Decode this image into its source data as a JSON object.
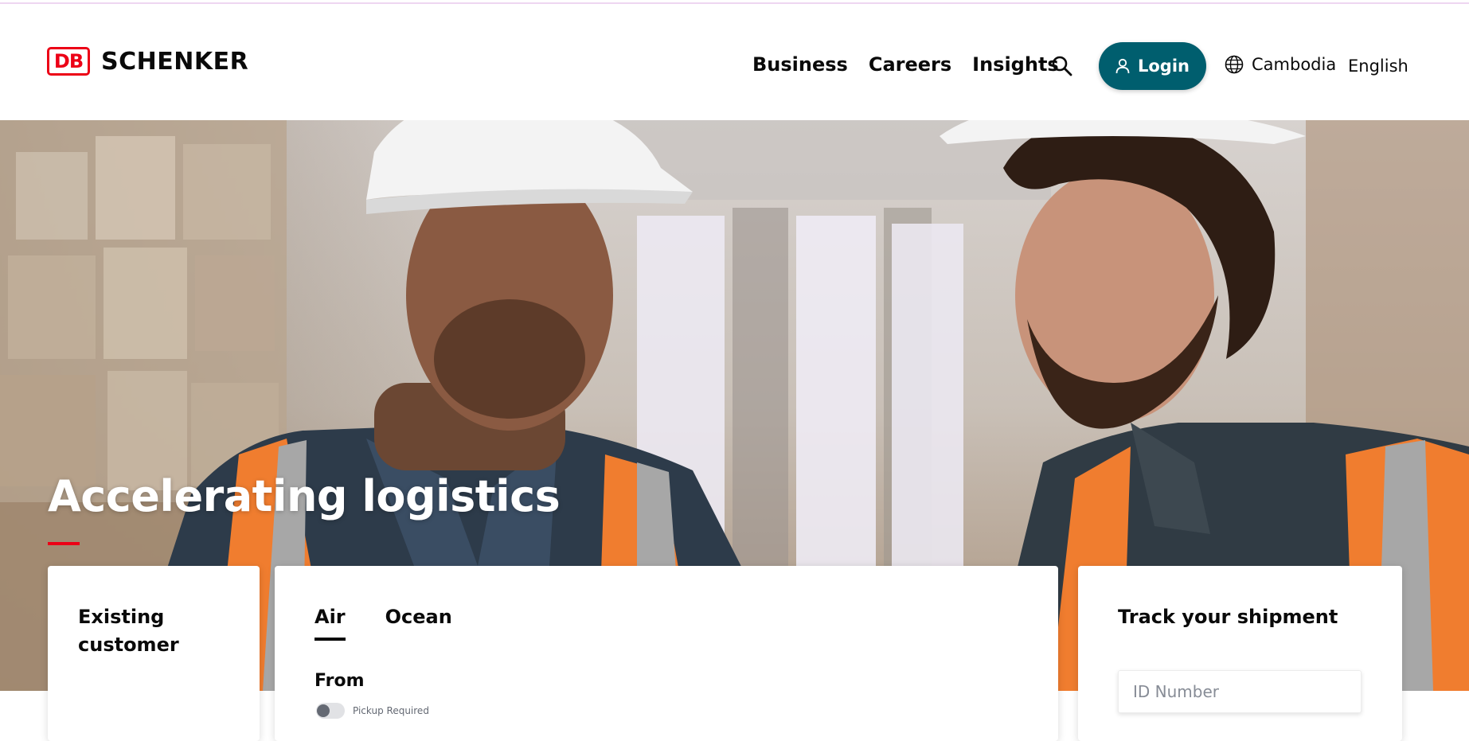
{
  "brand": {
    "mark": "DB",
    "name": "SCHENKER",
    "color": "#ec0016"
  },
  "nav": {
    "items": [
      {
        "label": "Business"
      },
      {
        "label": "Careers"
      },
      {
        "label": "Insights"
      }
    ],
    "search_icon": "search-icon",
    "login_label": "Login",
    "login_icon": "user-icon",
    "login_color": "#005e6e",
    "country_label": "Cambodia",
    "country_icon": "globe-icon",
    "language_label": "English"
  },
  "hero": {
    "title": "Accelerating logistics",
    "accent_color": "#ec0016"
  },
  "existing_customer": {
    "title": "Existing customer"
  },
  "quote": {
    "tabs": [
      {
        "label": "Air",
        "active": true
      },
      {
        "label": "Ocean",
        "active": false
      }
    ],
    "from_label": "From",
    "pickup_label": "Pickup Required",
    "pickup_enabled": false
  },
  "track": {
    "title": "Track your shipment",
    "id_placeholder": "ID Number"
  }
}
